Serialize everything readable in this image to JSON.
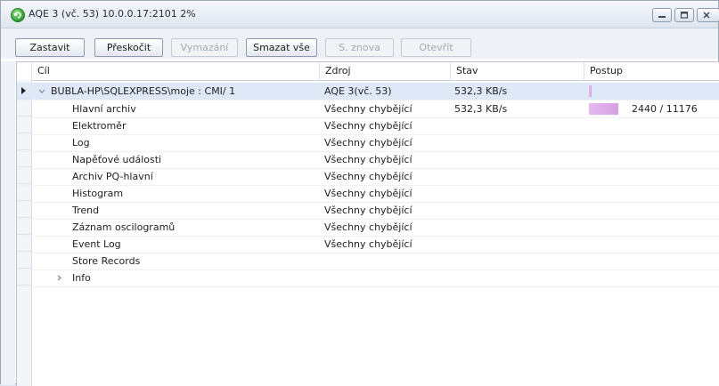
{
  "window": {
    "title": "AQE 3 (vč. 53) 10.0.0.17:2101 2%"
  },
  "toolbar": {
    "buttons": [
      {
        "label": "Zastavit",
        "enabled": true
      },
      {
        "label": "Přeskočit",
        "enabled": true
      },
      {
        "label": "Vymazání",
        "enabled": false
      },
      {
        "label": "Smazat vše",
        "enabled": true
      },
      {
        "label": "S. znova",
        "enabled": false
      },
      {
        "label": "Otevřít",
        "enabled": false
      }
    ]
  },
  "grid": {
    "columns": [
      "Cíl",
      "Zdroj",
      "Stav",
      "Postup"
    ],
    "parent_row": {
      "target": "BUBLA-HP\\SQLEXPRESS\\moje : CMI/ 1",
      "source": "AQE 3(vč. 53)",
      "status": "532,3 KB/s",
      "progress_fraction": 0.02
    },
    "rows": [
      {
        "target": "Hlavní archiv",
        "source": "Všechny chybějící",
        "status": "532,3 KB/s",
        "progress_text": "2440 / 11176",
        "progress_fraction": 0.2183
      },
      {
        "target": "Elektroměr",
        "source": "Všechny chybějící",
        "status": "",
        "progress_text": ""
      },
      {
        "target": "Log",
        "source": "Všechny chybějící",
        "status": "",
        "progress_text": ""
      },
      {
        "target": "Napěťové události",
        "source": "Všechny chybějící",
        "status": "",
        "progress_text": ""
      },
      {
        "target": "Archiv PQ-hlavní",
        "source": "Všechny chybějící",
        "status": "",
        "progress_text": ""
      },
      {
        "target": "Histogram",
        "source": "Všechny chybějící",
        "status": "",
        "progress_text": ""
      },
      {
        "target": "Trend",
        "source": "Všechny chybějící",
        "status": "",
        "progress_text": ""
      },
      {
        "target": "Záznam oscilogramů",
        "source": "Všechny chybějící",
        "status": "",
        "progress_text": ""
      },
      {
        "target": "Event Log",
        "source": "Všechny chybějící",
        "status": "",
        "progress_text": ""
      },
      {
        "target": "Store Records",
        "source": "",
        "status": "",
        "progress_text": ""
      },
      {
        "target": "Info",
        "source": "",
        "status": "",
        "progress_text": ""
      }
    ]
  },
  "icons": {
    "app": "refresh-icon",
    "minimize": "minimize-icon",
    "maximize": "maximize-icon",
    "close": "close-icon",
    "expand": "chevron-down-icon",
    "collapsed": "chevron-right-icon",
    "current_row": "row-indicator-icon"
  },
  "colors": {
    "selected_row": "#dfe8f6",
    "progress": "#d79fe3"
  }
}
